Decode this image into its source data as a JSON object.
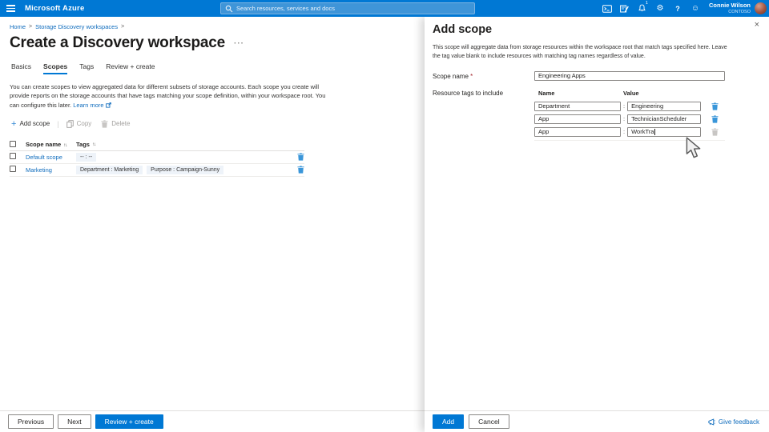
{
  "topbar": {
    "brand": "Microsoft Azure",
    "search_placeholder": "Search resources, services and docs",
    "notification_count": "1",
    "user": {
      "name": "Connie Wilson",
      "org": "CONTOSO"
    }
  },
  "breadcrumb": {
    "items": [
      "Home",
      "Storage Discovery workspaces"
    ]
  },
  "page": {
    "title": "Create a Discovery workspace",
    "tabs": [
      {
        "label": "Basics"
      },
      {
        "label": "Scopes"
      },
      {
        "label": "Tags"
      },
      {
        "label": "Review + create"
      }
    ],
    "description": "You can create scopes to view aggregated data for different subsets of storage accounts. Each scope you create will provide reports on the storage accounts that have tags matching your scope definition, within your workspace root. You can configure this later.",
    "learn_more": "Learn more"
  },
  "toolbar": {
    "add": "Add scope",
    "copy": "Copy",
    "delete": "Delete"
  },
  "table": {
    "columns": [
      "Scope name",
      "Tags"
    ],
    "rows": [
      {
        "name": "Default scope",
        "tags": [
          "-- : --"
        ]
      },
      {
        "name": "Marketing",
        "tags": [
          "Department : Marketing",
          "Purpose : Campaign-Sunny"
        ]
      }
    ]
  },
  "wizard_footer": {
    "previous": "Previous",
    "next": "Next",
    "review": "Review + create"
  },
  "panel": {
    "title": "Add scope",
    "description": "This scope will aggregate data from storage resources within the workspace root that match tags specified here. Leave the tag value blank to include resources with matching tag names regardless of value.",
    "scope_name_label": "Scope name",
    "scope_name_value": "Engineering Apps",
    "tags_label": "Resource tags to include",
    "grid": {
      "name_header": "Name",
      "value_header": "Value",
      "rows": [
        {
          "name": "Department",
          "value": "Engineering"
        },
        {
          "name": "App",
          "value": "TechnicianScheduler"
        },
        {
          "name": "App",
          "value": "WorkTra"
        }
      ]
    },
    "footer": {
      "add": "Add",
      "cancel": "Cancel",
      "feedback": "Give feedback"
    }
  },
  "icons": {
    "gear": "⚙",
    "smiley": "☺",
    "help": "?",
    "sort": "↑↓",
    "close": "×",
    "ellipsis": "···",
    "plus": "+",
    "divider": "|",
    "colon": ":",
    "required": "*"
  },
  "colors": {
    "accent": "#0078d4",
    "link": "#0f6cbd",
    "trash_active": "#3a96d9",
    "trash_disabled": "#c8c6c4",
    "chip_bg": "#eef3f9",
    "required": "#a4262c"
  }
}
